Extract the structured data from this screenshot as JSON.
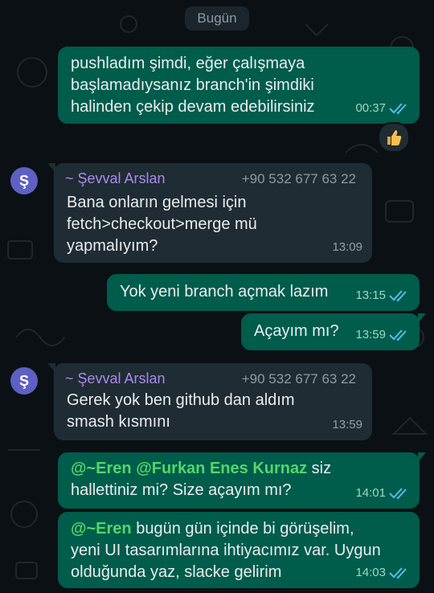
{
  "date_divider": "Bugün",
  "messages": [
    {
      "text": "pushladım şimdi, eğer çalışmaya başlamadıysanız branch'in şimdiki halinden çekip devam edebilirsiniz",
      "time": "00:37",
      "reaction": "thumbs-up"
    },
    {
      "sender": "~ Şevval Arslan",
      "phone": "+90 532 677 63 22",
      "avatar": "Ş",
      "text": "Bana onların gelmesi için fetch>checkout>merge mü yapmalıyım?",
      "time": "13:09"
    },
    {
      "text": "Yok yeni branch açmak lazım",
      "time": "13:15"
    },
    {
      "text": "Açayım mı?",
      "time": "13:59"
    },
    {
      "sender": "~ Şevval Arslan",
      "phone": "+90 532 677 63 22",
      "avatar": "Ş",
      "text": "Gerek yok ben github dan aldım smash kısmını",
      "time": "13:59"
    },
    {
      "mention1": "@~Eren",
      "mention2": "@Furkan Enes Kurnaz",
      "text_a": " siz",
      "text_b": "hallettiniz mi? Size açayım mı?",
      "time": "14:01"
    },
    {
      "mention": "@~Eren",
      "text_a": " bugün gün içinde bi görüşelim,",
      "text_b": "yeni UI tasarımlarına ihtiyacımız var. Uygun",
      "text_c": "olduğunda yaz, slacke gelirim",
      "time": "14:03"
    }
  ],
  "colors": {
    "outgoing": "#005c4b",
    "incoming": "#1f2c33",
    "read_ticks": "#53bdeb",
    "sender_name": "#a78bf0"
  }
}
